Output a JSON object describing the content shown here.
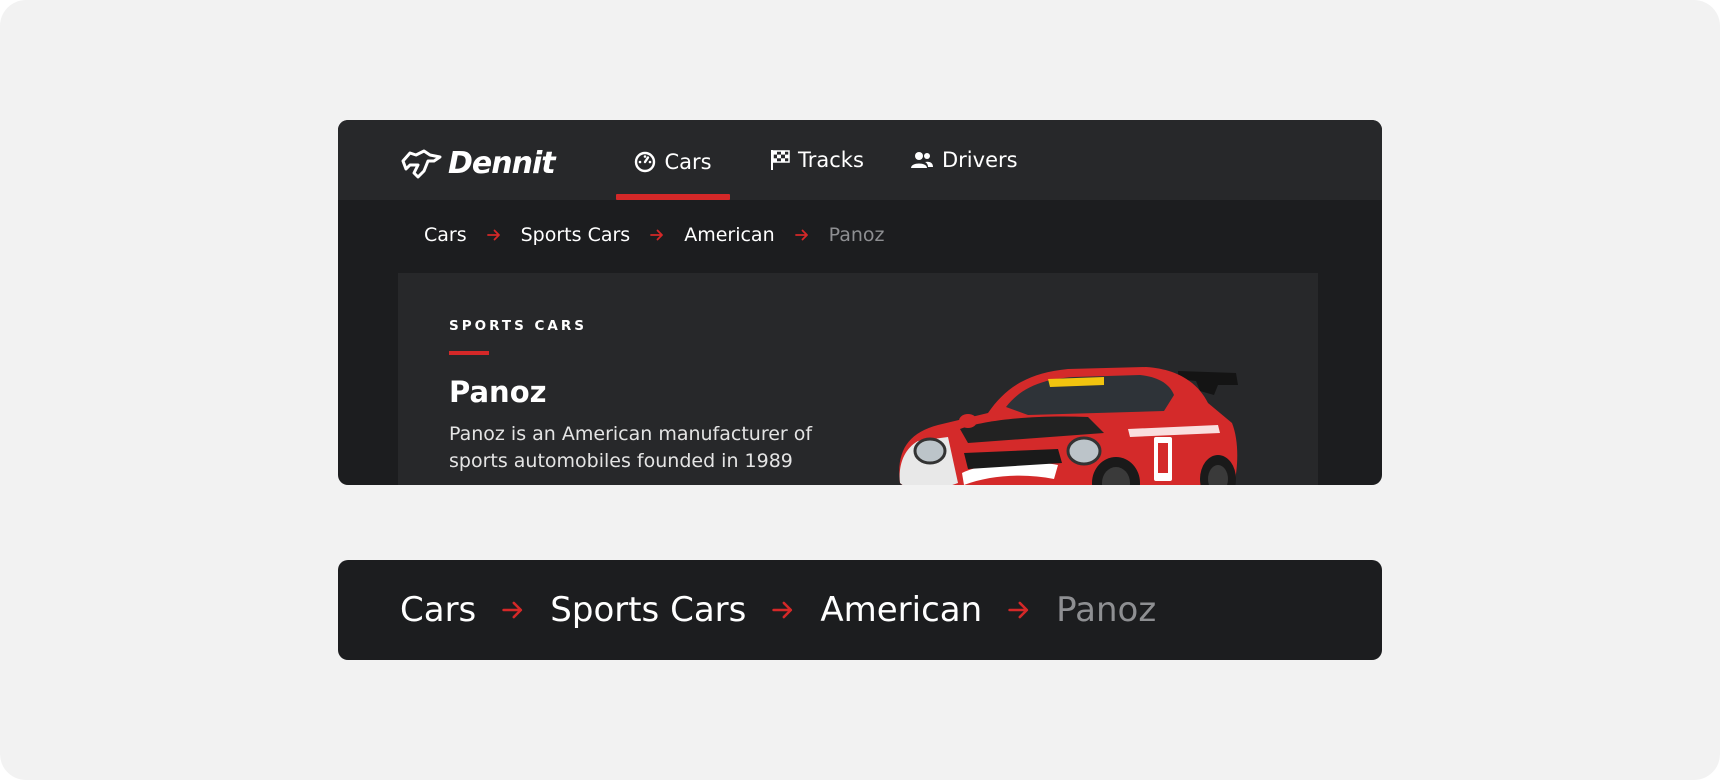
{
  "brand": {
    "name": "Dennit",
    "logo_icon": "horse-head-icon"
  },
  "nav": {
    "items": [
      {
        "label": "Cars",
        "icon": "speedometer-icon",
        "active": true
      },
      {
        "label": "Tracks",
        "icon": "checkered-flag-icon",
        "active": false
      },
      {
        "label": "Drivers",
        "icon": "users-icon",
        "active": false
      }
    ]
  },
  "breadcrumb": {
    "items": [
      "Cars",
      "Sports Cars",
      "American"
    ],
    "current": "Panoz",
    "separator_icon": "arrow-right-icon"
  },
  "card": {
    "eyebrow": "SPORTS CARS",
    "title": "Panoz",
    "description": "Panoz is an American manufacturer of sports automobiles founded in 1989",
    "image_icon": "race-car-image"
  },
  "colors": {
    "accent": "#d42828",
    "surface": "#1c1d1f",
    "surface_raised": "#27282a",
    "muted_text": "#8e8f92",
    "page_background": "#f2f2f2"
  }
}
